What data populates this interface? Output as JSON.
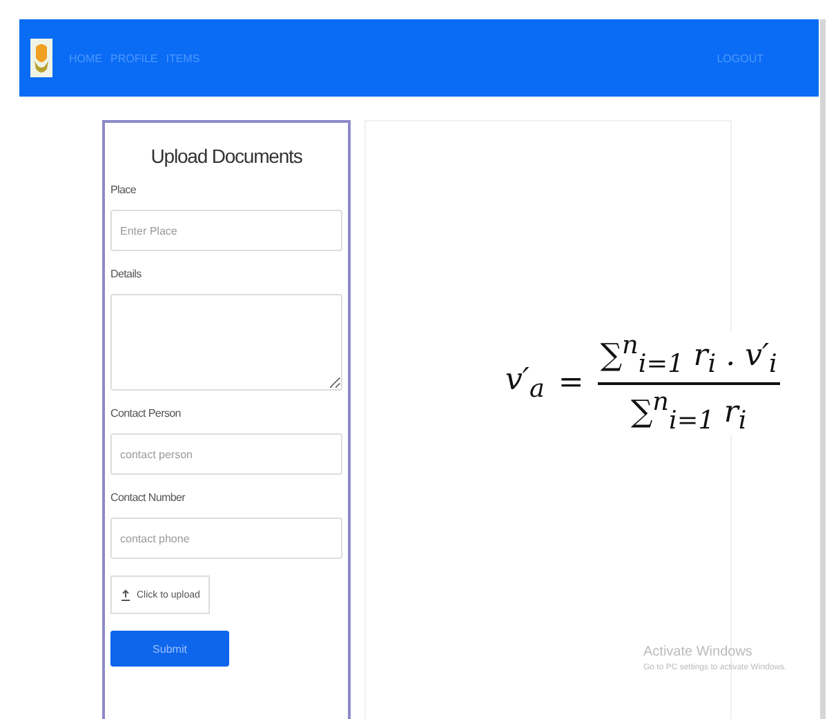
{
  "navbar": {
    "links": [
      "HOME",
      "PROFILE",
      "ITEMS"
    ],
    "logout": "LOGOUT"
  },
  "form": {
    "title": "Upload Documents",
    "fields": [
      {
        "kind": "input",
        "label": "Place",
        "placeholder": "Enter Place"
      },
      {
        "kind": "textarea",
        "label": "Details"
      },
      {
        "kind": "input",
        "label": "Contact Person",
        "placeholder": "contact person"
      },
      {
        "kind": "input",
        "label": "Contact Number",
        "placeholder": "contact phone"
      }
    ],
    "upload_button": "Click to upload",
    "submit_button": "Submit"
  },
  "formula": {
    "lhs": "v′$_{a}$",
    "equals": "=",
    "numerator": "∑$^{n}$$_{i=1}$ r$_{i}$ . v′$_{i}$",
    "denominator": "∑$^{n}$$_{i=1}$ r$_{i}$"
  },
  "watermark_os": {
    "title": "Activate Windows",
    "subtitle": "Go to PC settings to activate Windows."
  }
}
